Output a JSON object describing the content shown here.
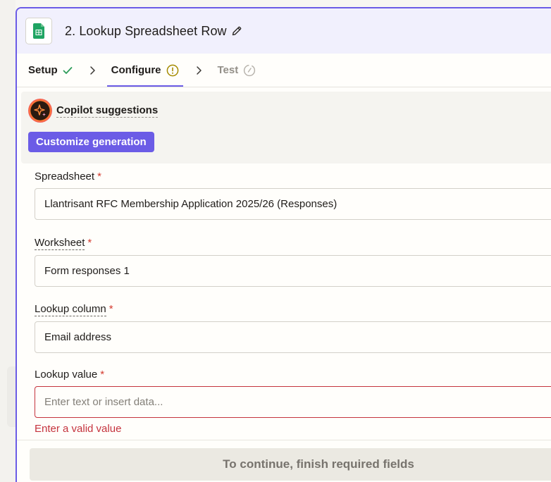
{
  "header": {
    "title": "2. Lookup Spreadsheet Row",
    "app_icon": "google-sheets-icon"
  },
  "tabs": [
    {
      "label": "Setup",
      "status": "complete",
      "icon": "check-icon"
    },
    {
      "label": "Configure",
      "status": "warning",
      "icon": "warning-icon"
    },
    {
      "label": "Test",
      "status": "disabled",
      "icon": "test-icon"
    }
  ],
  "copilot": {
    "label": "Copilot suggestions",
    "button": "Customize generation"
  },
  "fields": {
    "spreadsheet": {
      "label": "Spreadsheet",
      "required": "*",
      "value": "Llantrisant RFC Membership Application 2025/26 (Responses)"
    },
    "worksheet": {
      "label": "Worksheet",
      "required": "*",
      "value": "Form responses 1"
    },
    "lookup_column": {
      "label": "Lookup column",
      "required": "*",
      "value": "Email address"
    },
    "lookup_value": {
      "label": "Lookup value",
      "required": "*",
      "placeholder": "Enter text or insert data...",
      "error": "Enter a valid value"
    }
  },
  "footer": {
    "button": "To continue, finish required fields"
  },
  "colors": {
    "accent": "#6b5ce6",
    "error": "#c5333d",
    "success": "#2e9c5a",
    "warning": "#a48a00"
  }
}
